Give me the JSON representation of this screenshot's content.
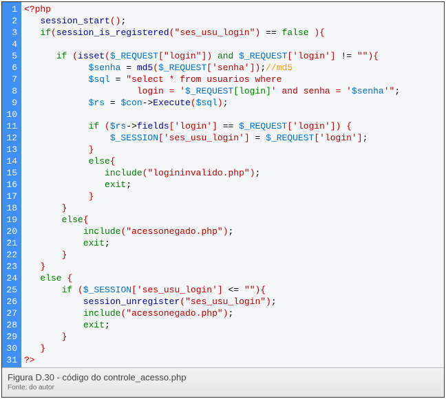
{
  "caption": {
    "title": "Figura D.30 - código do controle_acesso.php",
    "source": "Fonte: do autor"
  },
  "lines": [
    {
      "n": 1,
      "html": "<span class='br'>&lt;?php</span>"
    },
    {
      "n": 2,
      "html": "   <span class='fn'>session_start</span><span class='br'>()</span>;"
    },
    {
      "n": 3,
      "html": "   <span class='kw'>if</span><span class='br'>(</span><span class='fn'>session_is_registered</span><span class='br'>(</span><span class='str'>\"ses_usu_login\"</span><span class='br'>)</span> == <span class='kw'>false</span> <span class='br'>){</span>"
    },
    {
      "n": 4,
      "html": ""
    },
    {
      "n": 5,
      "html": "      <span class='kw'>if</span> <span class='br'>(</span><span class='fn'>isset</span><span class='br'>(</span><span class='var'>$_REQUEST</span><span class='br'>[</span><span class='str'>\"login\"</span><span class='br'>])</span> <span class='kw'>and</span> <span class='var'>$_REQUEST</span><span class='br'>[</span><span class='str'>'login'</span><span class='br'>]</span> != <span class='str'>\"\"</span><span class='br'>){</span>"
    },
    {
      "n": 6,
      "html": "            <span class='var'>$senha</span> = <span class='fn'>md5</span><span class='br'>(</span><span class='var'>$_REQUEST</span><span class='br'>[</span><span class='str'>'senha'</span><span class='br'>])</span>;<span class='cmt'>//md5</span>"
    },
    {
      "n": 7,
      "html": "            <span class='var'>$sql</span> = <span class='str'>\"select * from usuarios where</span>"
    },
    {
      "n": 8,
      "html": "                     <span class='str'>login = '</span><span class='var'>$_REQUEST</span><span class='arr'>[login]</span><span class='str'>' and senha = '</span><span class='var'>$senha</span><span class='str'>'\"</span>;"
    },
    {
      "n": 9,
      "html": "            <span class='var'>$rs</span> = <span class='var'>$con</span>-&gt;<span class='fn'>Execute</span><span class='br'>(</span><span class='var'>$sql</span><span class='br'>)</span>;"
    },
    {
      "n": 10,
      "html": ""
    },
    {
      "n": 11,
      "html": "            <span class='kw'>if</span> <span class='br'>(</span><span class='var'>$rs</span>-&gt;<span class='fn'>fields</span><span class='br'>[</span><span class='str'>'login'</span><span class='br'>]</span> == <span class='var'>$_REQUEST</span><span class='br'>[</span><span class='str'>'login'</span><span class='br'>])</span> <span class='br'>{</span>"
    },
    {
      "n": 12,
      "html": "                <span class='var'>$_SESSION</span><span class='br'>[</span><span class='str'>'ses_usu_login'</span><span class='br'>]</span> = <span class='var'>$_REQUEST</span><span class='br'>[</span><span class='str'>'login'</span><span class='br'>]</span>;"
    },
    {
      "n": 13,
      "html": "            <span class='br'>}</span>"
    },
    {
      "n": 14,
      "html": "            <span class='kw'>else</span><span class='br'>{</span>"
    },
    {
      "n": 15,
      "html": "               <span class='kw'>include</span><span class='br'>(</span><span class='str'>\"logininvalido.php\"</span><span class='br'>)</span>;"
    },
    {
      "n": 16,
      "html": "               <span class='kw'>exit</span>;"
    },
    {
      "n": 17,
      "html": "            <span class='br'>}</span>"
    },
    {
      "n": 18,
      "html": "       <span class='br'>}</span>"
    },
    {
      "n": 19,
      "html": "       <span class='kw'>else</span><span class='br'>{</span>"
    },
    {
      "n": 20,
      "html": "           <span class='kw'>include</span><span class='br'>(</span><span class='str'>\"acessonegado.php\"</span><span class='br'>)</span>;"
    },
    {
      "n": 21,
      "html": "           <span class='kw'>exit</span>;"
    },
    {
      "n": 22,
      "html": "       <span class='br'>}</span>"
    },
    {
      "n": 23,
      "html": "   <span class='br'>}</span>"
    },
    {
      "n": 24,
      "html": "   <span class='kw'>else</span> <span class='br'>{</span>"
    },
    {
      "n": 25,
      "html": "       <span class='kw'>if</span> <span class='br'>(</span><span class='var'>$_SESSION</span><span class='br'>[</span><span class='str'>'ses_usu_login'</span><span class='br'>]</span> &lt;= <span class='str'>\"\"</span><span class='br'>){</span>"
    },
    {
      "n": 26,
      "html": "           <span class='fn'>session_unregister</span><span class='br'>(</span><span class='str'>\"ses_usu_login\"</span><span class='br'>)</span>;"
    },
    {
      "n": 27,
      "html": "           <span class='kw'>include</span><span class='br'>(</span><span class='str'>\"acessonegado.php\"</span><span class='br'>)</span>;"
    },
    {
      "n": 28,
      "html": "           <span class='kw'>exit</span>;"
    },
    {
      "n": 29,
      "html": "       <span class='br'>}</span>"
    },
    {
      "n": 30,
      "html": "   <span class='br'>}</span>"
    },
    {
      "n": 31,
      "html": "<span class='br'>?&gt;</span>"
    }
  ]
}
